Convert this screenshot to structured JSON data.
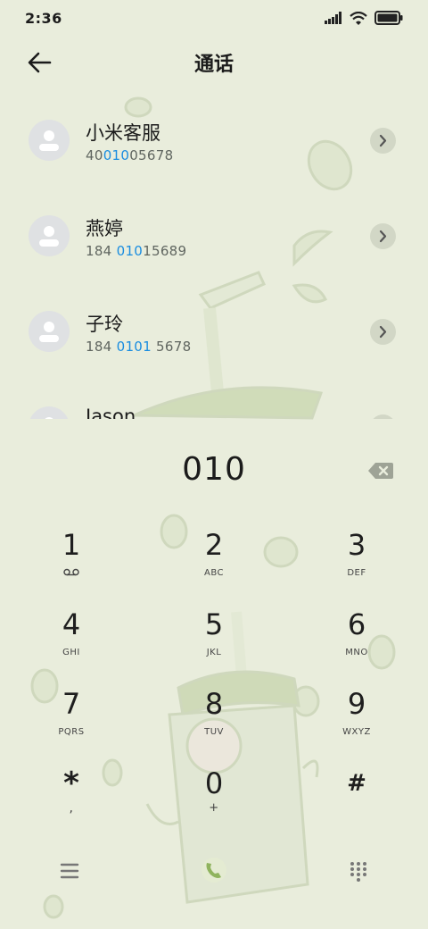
{
  "status": {
    "time": "2:36"
  },
  "header": {
    "title": "通话"
  },
  "contacts": [
    {
      "name": "小米客服",
      "num_pre": "40",
      "num_hl": "010",
      "num_post": "05678"
    },
    {
      "name": "燕婷",
      "num_pre": "184 ",
      "num_hl": "010",
      "num_post": "15689"
    },
    {
      "name": "子玲",
      "num_pre": "184 ",
      "num_hl": "0101",
      "num_post": " 5678"
    },
    {
      "name": "Jason",
      "num_pre": "",
      "num_hl": "",
      "num_post": ""
    }
  ],
  "dialer": {
    "number": "010"
  },
  "keys": [
    {
      "digit": "1",
      "letters": ""
    },
    {
      "digit": "2",
      "letters": "ABC"
    },
    {
      "digit": "3",
      "letters": "DEF"
    },
    {
      "digit": "4",
      "letters": "GHI"
    },
    {
      "digit": "5",
      "letters": "JKL"
    },
    {
      "digit": "6",
      "letters": "MNO"
    },
    {
      "digit": "7",
      "letters": "PQRS"
    },
    {
      "digit": "8",
      "letters": "TUV"
    },
    {
      "digit": "9",
      "letters": "WXYZ"
    },
    {
      "digit": "*",
      "letters": ","
    },
    {
      "digit": "0",
      "letters": "+"
    },
    {
      "digit": "#",
      "letters": ""
    }
  ],
  "colors": {
    "background": "#e9eddc",
    "highlight": "#1a8de0"
  },
  "icons": [
    "signal-icon",
    "wifi-icon",
    "battery-icon",
    "back-arrow-icon",
    "person-icon",
    "chevron-right-icon",
    "backspace-icon",
    "voicemail-icon",
    "menu-icon",
    "call-icon",
    "dialpad-icon"
  ]
}
